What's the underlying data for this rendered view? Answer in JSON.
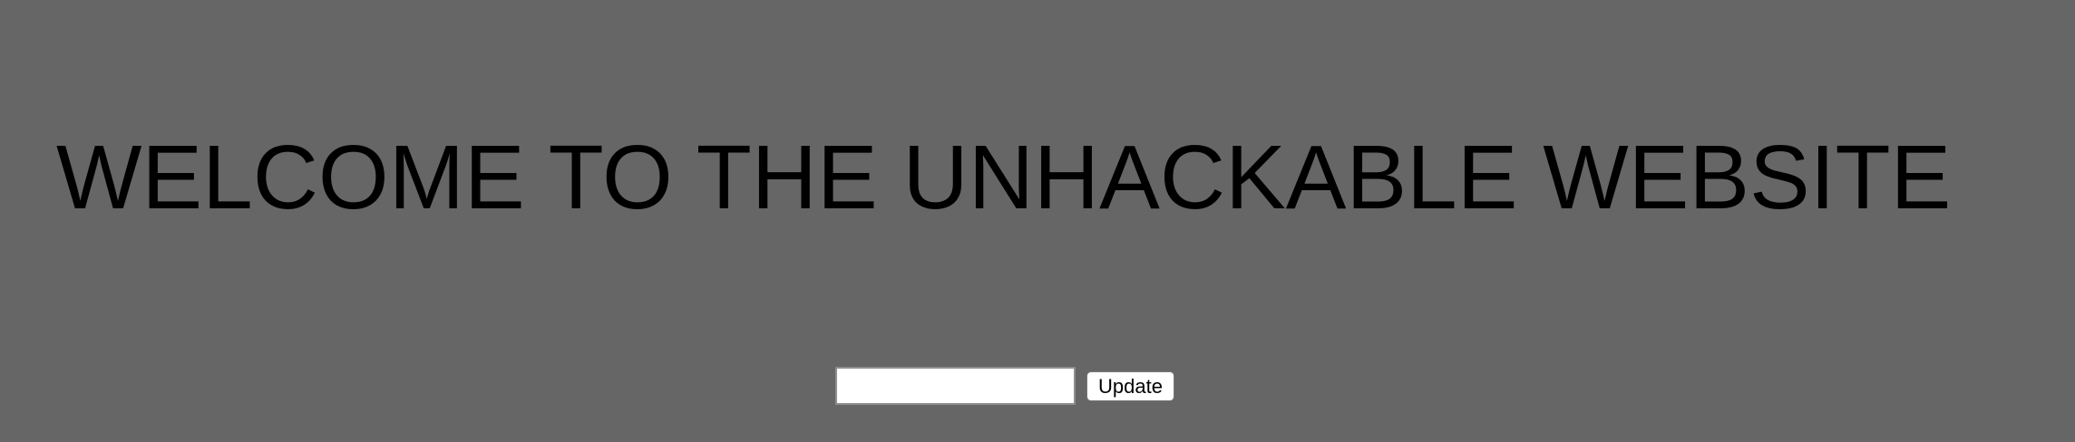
{
  "page": {
    "background_color": "#666666"
  },
  "header": {
    "title": "WELCOME TO THE UNHACKABLE WEBSITE"
  },
  "form": {
    "input_value": "",
    "input_placeholder": "",
    "update_label": "Update"
  }
}
